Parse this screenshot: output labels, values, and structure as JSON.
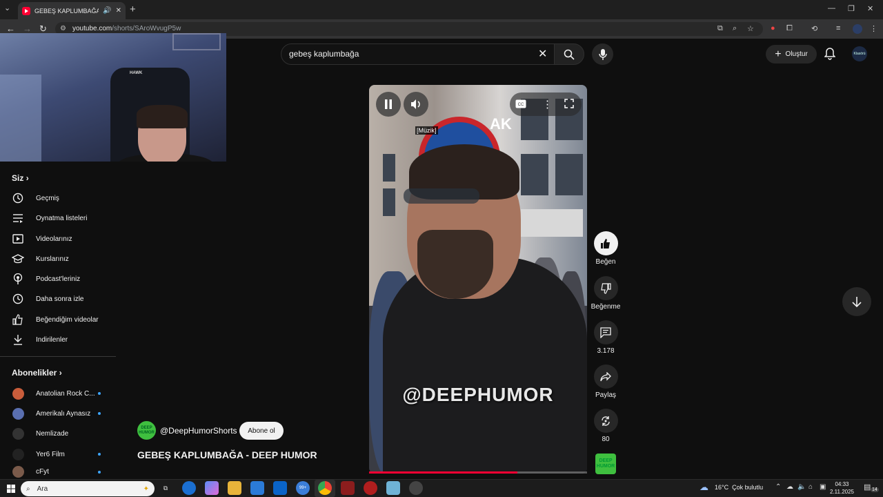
{
  "browser": {
    "tab_title": "GEBEŞ KAPLUMBAĞA - DEE",
    "url_host": "youtube.com",
    "url_path": "/shorts/SAroWvugP5w",
    "new_tab": "+",
    "tab_list": "⌄"
  },
  "search": {
    "query": "gebeş kaplumbağa"
  },
  "header": {
    "create_label": "Oluştur",
    "avatar_text": "Klasörü"
  },
  "webcam": {
    "chair_logo": "HAWK"
  },
  "sidebar": {
    "you_heading": "Siz",
    "you_items": [
      {
        "label": "Geçmiş",
        "icon": "history-icon"
      },
      {
        "label": "Oynatma listeleri",
        "icon": "playlist-icon"
      },
      {
        "label": "Videolarınız",
        "icon": "video-icon"
      },
      {
        "label": "Kurslarınız",
        "icon": "course-icon"
      },
      {
        "label": "Podcast'leriniz",
        "icon": "podcast-icon"
      },
      {
        "label": "Daha sonra izle",
        "icon": "clock-icon"
      },
      {
        "label": "Beğendiğim videolar",
        "icon": "thumbs-up-icon"
      },
      {
        "label": "İndirilenler",
        "icon": "download-icon"
      }
    ],
    "subs_heading": "Abonelikler",
    "subscriptions": [
      {
        "label": "Anatolian Rock C...",
        "new": true,
        "color": "#c95d3b"
      },
      {
        "label": "Amerikalı Aynasız",
        "new": true,
        "color": "#5a6fb0"
      },
      {
        "label": "Nemlizade",
        "new": false,
        "color": "#333333"
      },
      {
        "label": "Yer6 Film",
        "new": true,
        "color": "#222222"
      },
      {
        "label": "cFyt",
        "new": true,
        "color": "#7a5a4a"
      }
    ]
  },
  "video": {
    "caption": "[Müzik]",
    "watermark": "@DEEPHUMOR",
    "progress": 0.68,
    "sign_text": "AK"
  },
  "actions": {
    "like_label": "Beğen",
    "dislike_label": "Beğenme",
    "comments_count": "3.178",
    "share_label": "Paylaş",
    "remix_count": "80"
  },
  "channel": {
    "handle": "@DeepHumorShorts",
    "subscribe_label": "Abone ol",
    "avatar_text": "DEEP HUMOR",
    "video_title": "GEBEŞ KAPLUMBAĞA - DEEP HUMOR"
  },
  "taskbar": {
    "search_placeholder": "Ara",
    "weather_temp": "16°C",
    "weather_text": "Çok bulutlu",
    "time": "04:33",
    "date": "2.11.2025",
    "notif_count": "14",
    "badge_99": "99+"
  },
  "colors": {
    "accent_red": "#ff0033",
    "brand_green": "#3fbf3f",
    "dot_blue": "#3ea6ff"
  }
}
